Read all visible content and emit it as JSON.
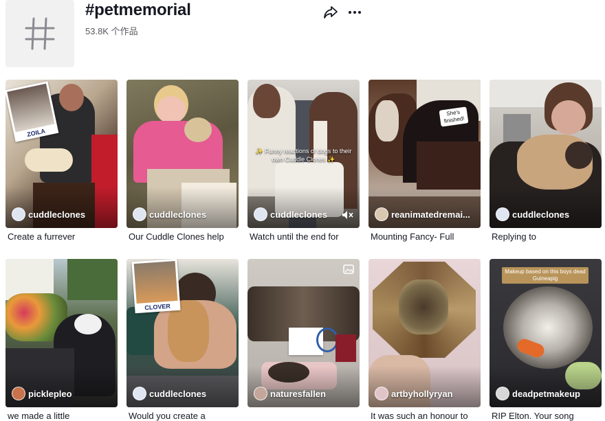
{
  "page": {
    "title": "#petmemorial",
    "count": "53.8K 个作品",
    "hash_glyph": "#",
    "icons": {
      "share": "share-icon",
      "more": "more-icon",
      "mute": "mute-icon",
      "photo": "photo-icon"
    }
  },
  "cards": [
    {
      "author": "cuddleclones",
      "caption": "Create a furrever",
      "polaroid_label": "ZOILA"
    },
    {
      "author": "cuddleclones",
      "caption": "Our Cuddle Clones help"
    },
    {
      "author": "cuddleclones",
      "caption": "Watch until the end for",
      "overlay": "✨ Funny reactions of dogs to their own Cuddle Clones ✨"
    },
    {
      "author": "reanimatedremai...",
      "caption": "Mounting Fancy- Full",
      "sticker": "She's finished!"
    },
    {
      "author": "cuddleclones",
      "caption": "Replying to"
    },
    {
      "author": "picklepleo",
      "caption": "we made a little"
    },
    {
      "author": "cuddleclones",
      "caption": "Would you create a",
      "polaroid_label": "CLOVER"
    },
    {
      "author": "naturesfallen",
      "caption": ""
    },
    {
      "author": "artbyhollyryan",
      "caption": "It was such an honour to"
    },
    {
      "author": "deadpetmakeup",
      "caption": "RIP Elton. Your song",
      "overlay": "Makeup based on this boys dead Guineapig"
    }
  ],
  "colors": {
    "text": "#161823",
    "muted": "#57585f",
    "tile": "#f1f1f2"
  }
}
